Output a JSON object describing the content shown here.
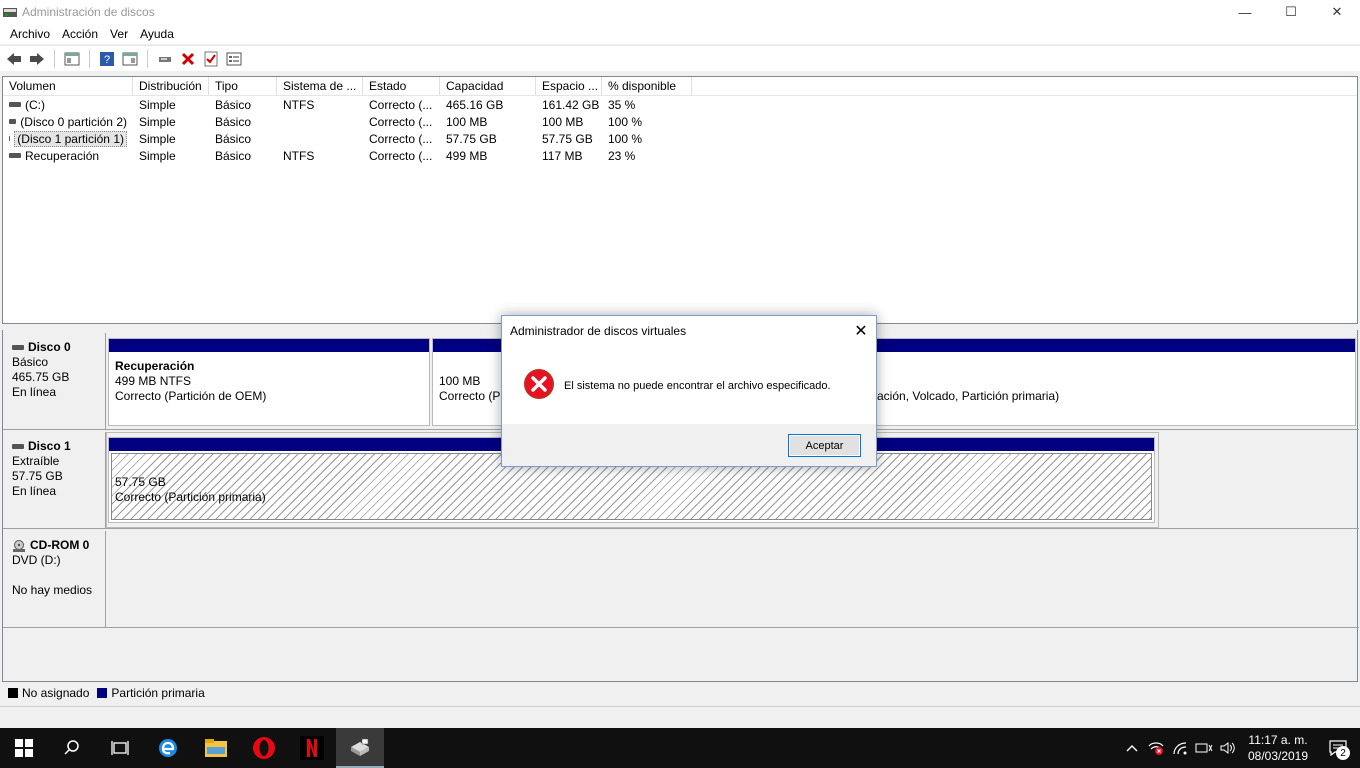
{
  "window": {
    "title": "Administración de discos",
    "minimize": "—",
    "maximize": "☐",
    "close": "✕"
  },
  "menu": [
    "Archivo",
    "Acción",
    "Ver",
    "Ayuda"
  ],
  "toolbar": [
    "back-icon",
    "forward-icon",
    "console-tree-icon",
    "help-icon",
    "properties-icon",
    "connect-icon",
    "delete-icon",
    "check-icon",
    "list-icon"
  ],
  "volumes": {
    "columns": [
      "Volumen",
      "Distribución",
      "Tipo",
      "Sistema de ...",
      "Estado",
      "Capacidad",
      "Espacio ...",
      "% disponible"
    ],
    "rows": [
      [
        "(C:)",
        "Simple",
        "Básico",
        "NTFS",
        "Correcto (...",
        "465.16 GB",
        "161.42 GB",
        "35 %"
      ],
      [
        "(Disco 0 partición 2)",
        "Simple",
        "Básico",
        "",
        "Correcto (...",
        "100 MB",
        "100 MB",
        "100 %"
      ],
      [
        "(Disco 1 partición 1)",
        "Simple",
        "Básico",
        "",
        "Correcto (...",
        "57.75 GB",
        "57.75 GB",
        "100 %"
      ],
      [
        "Recuperación",
        "Simple",
        "Básico",
        "NTFS",
        "Correcto (...",
        "499 MB",
        "117 MB",
        "23 %"
      ]
    ]
  },
  "disks": {
    "disk0": {
      "name": "Disco 0",
      "type": "Básico",
      "size": "465.75 GB",
      "status": "En línea",
      "p1": {
        "name": "Recuperación",
        "size": "499 MB NTFS",
        "status": "Correcto (Partición de OEM)"
      },
      "p2": {
        "size": "100 MB",
        "status": "Correcto (Pa"
      },
      "p3": {
        "status": "ación, Volcado, Partición primaria)"
      }
    },
    "disk1": {
      "name": "Disco 1",
      "type": "Extraíble",
      "size": "57.75 GB",
      "status": "En línea",
      "p1": {
        "size": "57.75 GB",
        "status": "Correcto (Partición primaria)"
      }
    },
    "cdrom": {
      "name": "CD-ROM 0",
      "drive": "DVD (D:)",
      "status": "No hay medios"
    }
  },
  "legend": {
    "unallocated": "No asignado",
    "unallocated_color": "#000000",
    "primary": "Partición primaria",
    "primary_color": "#000080"
  },
  "dialog": {
    "title": "Administrador de discos virtuales",
    "message": "El sistema no puede encontrar el archivo especificado.",
    "button": "Aceptar",
    "close": "✕",
    "icon": "error-icon"
  },
  "taskbar": {
    "apps": [
      "windows-start-icon",
      "search-icon",
      "task-view-icon",
      "edge-icon",
      "file-explorer-icon",
      "opera-icon",
      "netflix-icon",
      "disk-management-icon"
    ],
    "time": "11:17 a. m.",
    "date": "08/03/2019",
    "notifications": "2"
  }
}
